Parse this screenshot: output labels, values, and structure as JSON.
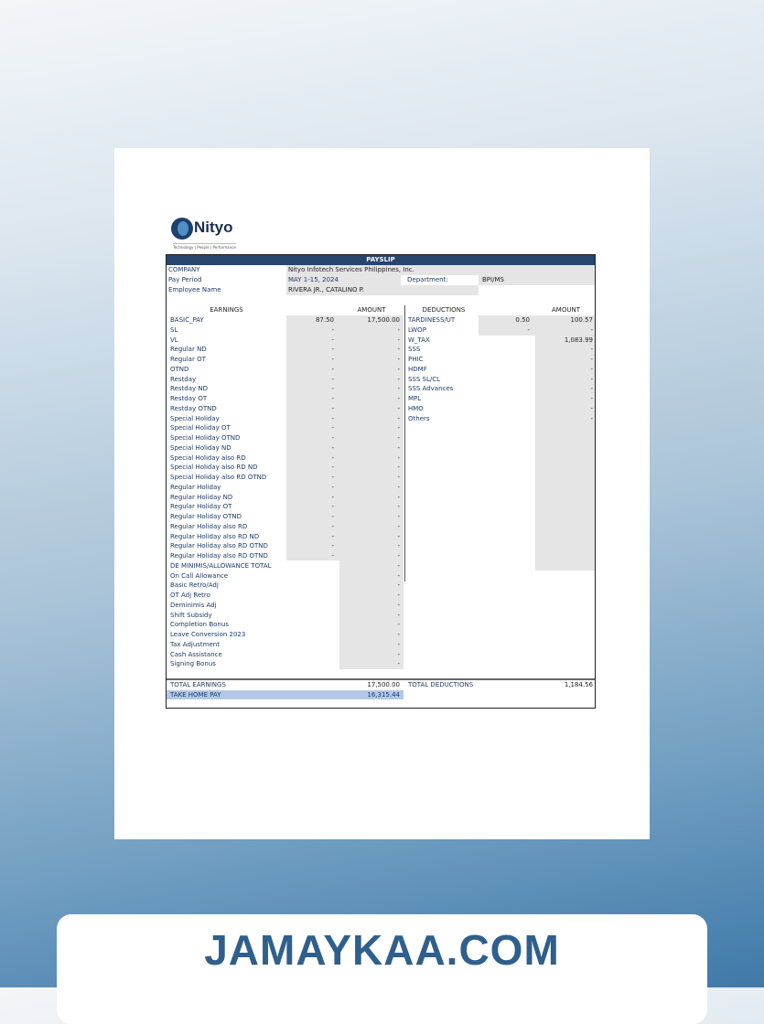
{
  "logo": {
    "name": "Nityo",
    "tagline": "Technology | People | Performance"
  },
  "payslip": {
    "title": "PAYSLIP",
    "company_label": "COMPANY",
    "company": "Nityo Infotech Services Philippines, Inc.",
    "pay_period_label": "Pay Period",
    "pay_period": "MAY 1-15, 2024",
    "department_label": "Department:",
    "department": "BPI/MS",
    "employee_label": "Employee Name",
    "employee": "RIVERA JR., CATALINO P.",
    "earnings_header": "EARNINGS",
    "amount_header": "AMOUNT",
    "deductions_header": "DEDUCTIONS",
    "deductions_amount_header": "AMOUNT",
    "earnings": [
      {
        "label": "BASIC_PAY",
        "qty": "87.50",
        "amount": "17,500.00"
      },
      {
        "label": "SL",
        "qty": "-",
        "amount": "-"
      },
      {
        "label": "VL",
        "qty": "-",
        "amount": "-"
      },
      {
        "label": "Regular ND",
        "qty": "-",
        "amount": "-"
      },
      {
        "label": "Regular OT",
        "qty": "-",
        "amount": "-"
      },
      {
        "label": "OTND",
        "qty": "-",
        "amount": "-"
      },
      {
        "label": "Restday",
        "qty": "-",
        "amount": "-"
      },
      {
        "label": "Restday ND",
        "qty": "-",
        "amount": "-"
      },
      {
        "label": "Restday OT",
        "qty": "-",
        "amount": "-"
      },
      {
        "label": "Restday OTND",
        "qty": "-",
        "amount": "-"
      },
      {
        "label": "Special Holiday",
        "qty": "-",
        "amount": "-"
      },
      {
        "label": "Special Holiday OT",
        "qty": "-",
        "amount": "-"
      },
      {
        "label": "Special Holiday OTND",
        "qty": "-",
        "amount": "-"
      },
      {
        "label": "Special Holiday ND",
        "qty": "-",
        "amount": "-"
      },
      {
        "label": "Special Holiday also RD",
        "qty": "-",
        "amount": "-"
      },
      {
        "label": "Special Holiday also RD ND",
        "qty": "-",
        "amount": "-"
      },
      {
        "label": "Special Holiday also RD OTND",
        "qty": "-",
        "amount": "-"
      },
      {
        "label": "Regular Holiday",
        "qty": "-",
        "amount": "-"
      },
      {
        "label": "Regular Holiday ND",
        "qty": "-",
        "amount": "-"
      },
      {
        "label": "Regular Holiday OT",
        "qty": "-",
        "amount": "-"
      },
      {
        "label": "Regular Holiday OTND",
        "qty": "-",
        "amount": "-"
      },
      {
        "label": "Regular Holiday also RD",
        "qty": "-",
        "amount": "-"
      },
      {
        "label": "Regular Holiday also RD ND",
        "qty": "-",
        "amount": "-"
      },
      {
        "label": "Regular Holiday also RD OTND",
        "qty": "-",
        "amount": "-"
      },
      {
        "label": "Regular Holiday also RD OTND",
        "qty": "-",
        "amount": "-"
      },
      {
        "label": "DE MINIMIS/ALLOWANCE TOTAL",
        "qty": "",
        "amount": "-"
      },
      {
        "label": "On Call Allowance",
        "qty": "",
        "amount": "-"
      },
      {
        "label": "Basic Retro/Adj",
        "qty": "",
        "amount": "-"
      },
      {
        "label": "OT Adj Retro",
        "qty": "",
        "amount": "-"
      },
      {
        "label": "Deminimis Adj",
        "qty": "",
        "amount": "-"
      },
      {
        "label": "Shift Subsidy",
        "qty": "",
        "amount": "-"
      },
      {
        "label": "Completion Bonus",
        "qty": "",
        "amount": "-"
      },
      {
        "label": "Leave Conversion 2023",
        "qty": "",
        "amount": "-"
      },
      {
        "label": "Tax Adjustment",
        "qty": "",
        "amount": "-"
      },
      {
        "label": "Cash Assistance",
        "qty": "",
        "amount": "-"
      },
      {
        "label": "Signing Bonus",
        "qty": "",
        "amount": "-"
      }
    ],
    "deductions": [
      {
        "label": "TARDINESS/UT",
        "qty": "0.50",
        "amount": "100.57"
      },
      {
        "label": "LWOP",
        "qty": "-",
        "amount": "-"
      },
      {
        "label": "W_TAX",
        "qty": "",
        "amount": "1,083.99"
      },
      {
        "label": "SSS",
        "qty": "",
        "amount": "-"
      },
      {
        "label": "PHIC",
        "qty": "",
        "amount": "-"
      },
      {
        "label": "HDMF",
        "qty": "",
        "amount": "-"
      },
      {
        "label": "SSS SL/CL",
        "qty": "",
        "amount": "-"
      },
      {
        "label": "SSS Advances",
        "qty": "",
        "amount": "-"
      },
      {
        "label": "MPL",
        "qty": "",
        "amount": "-"
      },
      {
        "label": "HMO",
        "qty": "",
        "amount": "-"
      },
      {
        "label": "Others",
        "qty": "",
        "amount": "-"
      }
    ],
    "total_earnings_label": "TOTAL EARNINGS",
    "total_earnings": "17,500.00",
    "total_deductions_label": "TOTAL DEDUCTIONS",
    "total_deductions": "1,184.56",
    "take_home_label": "TAKE HOME PAY",
    "take_home": "16,315.44"
  },
  "watermark": "JAMAYKAA.COM",
  "colors": {
    "header_bar": "#27456d",
    "take_home_highlight": "#b4c7e7",
    "text": "#1b3a66"
  }
}
